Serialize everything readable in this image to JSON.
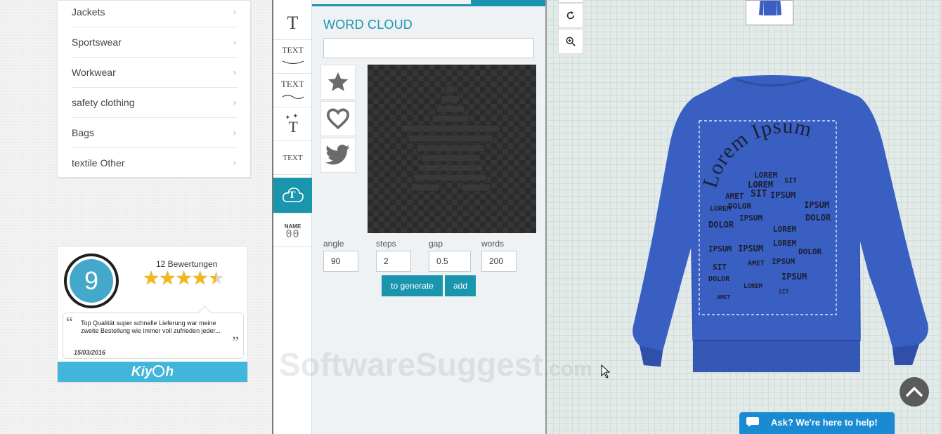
{
  "categories": [
    {
      "label": "Jackets"
    },
    {
      "label": "Sportswear"
    },
    {
      "label": "Workwear"
    },
    {
      "label": "safety clothing"
    },
    {
      "label": "Bags"
    },
    {
      "label": "textile Other"
    }
  ],
  "review": {
    "score": "9",
    "count_label": "12 Bewertungen",
    "rating_stars": 4.5,
    "text": "Top Qualität super schnelle Lieferung war meine zweite Bestellung wie immer voll zufrieden jeder...",
    "date": "15/03/2016",
    "brand": "Kiy",
    "brand_suffix": "h"
  },
  "tools": [
    {
      "name": "text-tool",
      "glyph": "T"
    },
    {
      "name": "curved-text-tool",
      "glyph": "TEXT"
    },
    {
      "name": "wave-text-tool",
      "glyph": "TEXT"
    },
    {
      "name": "effects-text-tool",
      "glyph": "T"
    },
    {
      "name": "small-text-tool",
      "glyph": "TEXT"
    },
    {
      "name": "word-cloud-tool",
      "glyph": "T"
    },
    {
      "name": "name-number-tool",
      "glyph": "NAME",
      "glyph2": "00"
    }
  ],
  "panel": {
    "title": "WORD CLOUD",
    "input_value": "",
    "shapes": [
      "star-icon",
      "heart-icon",
      "twitter-icon"
    ],
    "params": [
      {
        "label": "angle",
        "value": "90"
      },
      {
        "label": "steps",
        "value": "2"
      },
      {
        "label": "gap",
        "value": "0.5"
      },
      {
        "label": "words",
        "value": "200"
      }
    ],
    "generate_label": "to generate",
    "add_label": "add"
  },
  "design": {
    "arc_text": "Lorem Ipsum",
    "cloud_words": [
      "LOREM",
      "IPSUM",
      "DOLOR",
      "SIT",
      "AMET"
    ],
    "garment_color": "#3a5fc3"
  },
  "chat": {
    "label": "Ask? We're here to help!"
  },
  "watermark": {
    "text": "SoftwareSuggest",
    "suffix": ".com"
  },
  "colors": {
    "accent": "#1a95ae",
    "chat": "#1a8ad3",
    "score": "#43a8c9"
  }
}
